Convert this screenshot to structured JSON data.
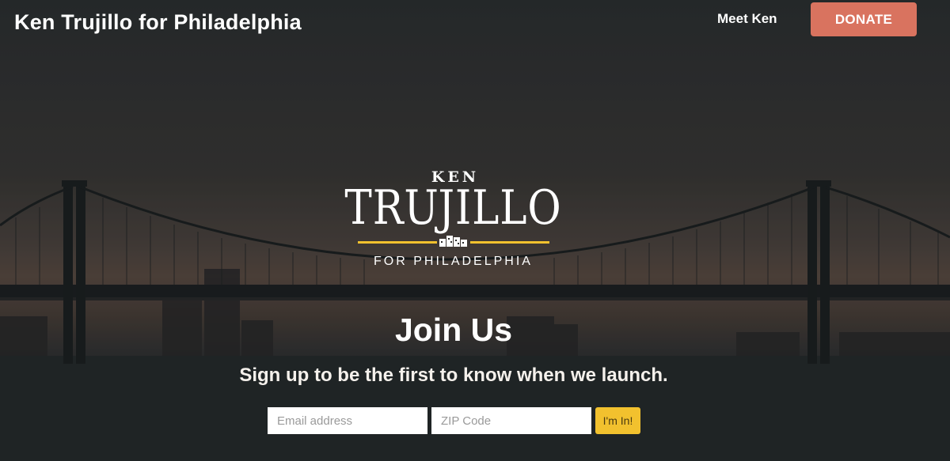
{
  "header": {
    "site_title": "Ken Trujillo for Philadelphia",
    "nav_meet": "Meet Ken",
    "donate_label": "DONATE"
  },
  "logo": {
    "top_word": "KEN",
    "name": "TRUJILLO",
    "sub": "FOR PHILADELPHIA"
  },
  "signup": {
    "heading": "Join Us",
    "tagline": "Sign up to be the first to know when we launch.",
    "email_placeholder": "Email address",
    "zip_placeholder": "ZIP Code",
    "submit_label": "I'm In!"
  },
  "colors": {
    "donate": "#d9735f",
    "accent_yellow": "#f2c12e"
  }
}
